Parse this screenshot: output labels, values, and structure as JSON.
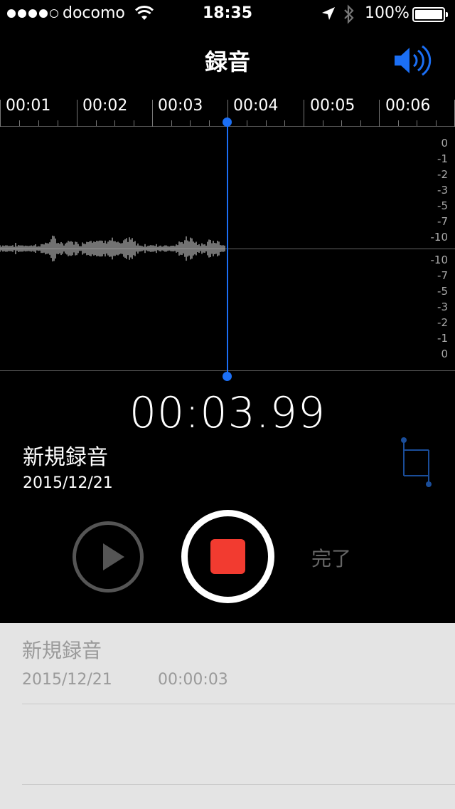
{
  "status_bar": {
    "carrier": "docomo",
    "time": "18:35",
    "battery_percent": "100%"
  },
  "nav": {
    "title": "録音",
    "speaker_icon": "speaker-volume-icon"
  },
  "timeline": {
    "ticks": [
      "00:01",
      "00:02",
      "00:03",
      "00:04",
      "00:05",
      "00:06"
    ]
  },
  "waveform": {
    "db_scale_top": [
      "0",
      "-1",
      "-2",
      "-3",
      "-5",
      "-7",
      "-10"
    ],
    "db_scale_bottom": [
      "-10",
      "-7",
      "-5",
      "-3",
      "-2",
      "-1",
      "0"
    ]
  },
  "recorder": {
    "timer": "00:03.99",
    "title": "新規録音",
    "date": "2015/12/21",
    "done_label": "完了"
  },
  "recordings": [
    {
      "title": "新規録音",
      "date": "2015/12/21",
      "duration": "00:00:03"
    }
  ],
  "colors": {
    "accent_blue": "#1b6ff5",
    "record_red": "#f23b30"
  }
}
